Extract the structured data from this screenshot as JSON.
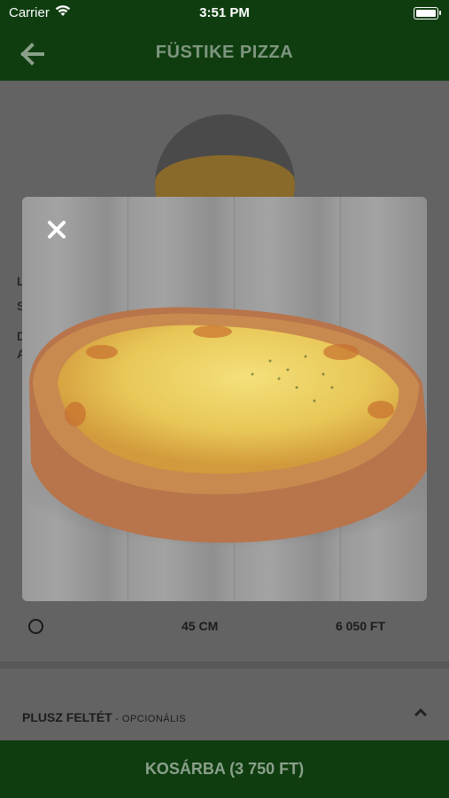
{
  "status_bar": {
    "carrier": "Carrier",
    "time": "3:51 PM"
  },
  "nav": {
    "back_icon": "back-arrow-icon",
    "title": "FÜSTIKE PIZZA"
  },
  "background_hints": [
    "L",
    "S",
    "D",
    "A"
  ],
  "size_option": {
    "size": "45 CM",
    "price": "6 050 FT"
  },
  "extras": {
    "label": "PLUSZ FELTÉT",
    "optional": " - OPCIONÁLIS",
    "icon": "chevron-up-icon"
  },
  "cart": {
    "label": "KOSÁRBA (3 750 FT)"
  },
  "modal": {
    "close_icon": "close-icon"
  },
  "colors": {
    "nav": "#0f3d10",
    "nav_text": "#8aa08a",
    "overlay": "#636363"
  }
}
